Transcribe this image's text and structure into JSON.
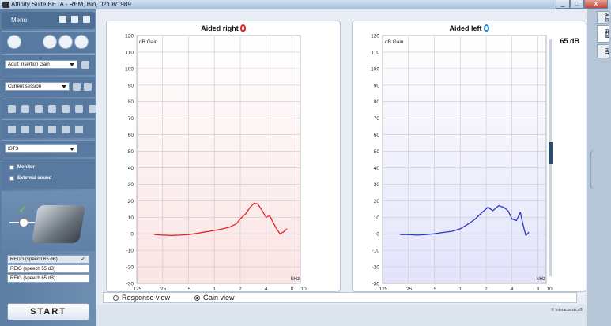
{
  "window": {
    "title": "Affinity Suite BETA - REM, Bin, 02/08/1989",
    "buttons": {
      "minimize": "_",
      "maximize": "□",
      "close": "x"
    }
  },
  "sidebar": {
    "menu_label": "Menu",
    "measurement_dropdown": "Adult Insertion Gain",
    "session_dropdown": "Current session",
    "signal_dropdown": "ISTS",
    "monitor_label": "Monitor",
    "external_sound_label": "External sound",
    "curve_list": [
      {
        "label": "REUG (speech 65 dB)",
        "selected": true
      },
      {
        "label": "REIG (speech 55 dB)",
        "selected": false
      },
      {
        "label": "REIG (speech 65 dB)",
        "selected": false
      }
    ],
    "start_label": "START"
  },
  "charts": {
    "right_title": "Aided right",
    "left_title": "Aided left",
    "level_label": "65 dB"
  },
  "view_options": {
    "response": "Response view",
    "gain": "Gain view",
    "selected": "gain"
  },
  "footer": {
    "brand": "© Interacoustics®"
  },
  "right_tabs": [
    "AUD",
    "REM",
    "HIT"
  ],
  "colors": {
    "right_curve": "#e8202a",
    "left_curve": "#2b36c8",
    "right_fill": "#fbe3e3",
    "left_fill": "#e2e3fb"
  },
  "chart_data": [
    {
      "type": "line",
      "title": "Aided right",
      "ylabel": "dB Gain",
      "xlabel": "kHz",
      "x_scale": "log",
      "xlim": [
        0.125,
        10
      ],
      "ylim": [
        -30,
        120
      ],
      "x_ticks": [
        0.125,
        0.25,
        0.5,
        1,
        2,
        4,
        8,
        10
      ],
      "x_tick_labels": [
        ".125",
        ".25",
        ".5",
        "1",
        "2",
        "4",
        "8",
        "10"
      ],
      "y_ticks": [
        120,
        110,
        100,
        90,
        80,
        70,
        60,
        50,
        40,
        30,
        20,
        10,
        0,
        -10,
        -20,
        -30
      ],
      "grid": true,
      "series": [
        {
          "color": "#e8202a",
          "points": [
            [
              0.2,
              -0.5
            ],
            [
              0.25,
              -0.8
            ],
            [
              0.315,
              -1
            ],
            [
              0.4,
              -0.8
            ],
            [
              0.5,
              -0.5
            ],
            [
              0.63,
              0.3
            ],
            [
              0.8,
              1.2
            ],
            [
              1.0,
              2
            ],
            [
              1.25,
              3
            ],
            [
              1.5,
              4
            ],
            [
              1.8,
              6
            ],
            [
              2.0,
              9
            ],
            [
              2.3,
              12
            ],
            [
              2.6,
              16
            ],
            [
              2.9,
              18.5
            ],
            [
              3.2,
              18
            ],
            [
              3.6,
              14
            ],
            [
              4.0,
              10
            ],
            [
              4.4,
              11
            ],
            [
              4.8,
              7
            ],
            [
              5.3,
              3
            ],
            [
              5.8,
              0
            ],
            [
              6.3,
              1
            ],
            [
              7.0,
              3
            ]
          ]
        }
      ]
    },
    {
      "type": "line",
      "title": "Aided left",
      "ylabel": "dB Gain",
      "xlabel": "kHz",
      "x_scale": "log",
      "xlim": [
        0.125,
        10
      ],
      "ylim": [
        -30,
        120
      ],
      "x_ticks": [
        0.125,
        0.25,
        0.5,
        1,
        2,
        4,
        8,
        10
      ],
      "x_tick_labels": [
        ".125",
        ".25",
        ".5",
        "1",
        "2",
        "4",
        "8",
        "10"
      ],
      "y_ticks": [
        120,
        110,
        100,
        90,
        80,
        70,
        60,
        50,
        40,
        30,
        20,
        10,
        0,
        -10,
        -20,
        -30
      ],
      "grid": true,
      "series": [
        {
          "color": "#2b36c8",
          "points": [
            [
              0.2,
              -0.5
            ],
            [
              0.25,
              -0.5
            ],
            [
              0.315,
              -0.8
            ],
            [
              0.4,
              -0.5
            ],
            [
              0.5,
              0
            ],
            [
              0.63,
              0.8
            ],
            [
              0.8,
              1.5
            ],
            [
              1.0,
              3
            ],
            [
              1.25,
              6
            ],
            [
              1.5,
              9
            ],
            [
              1.8,
              13
            ],
            [
              2.1,
              16
            ],
            [
              2.4,
              14
            ],
            [
              2.8,
              17
            ],
            [
              3.2,
              16
            ],
            [
              3.6,
              14
            ],
            [
              4.0,
              9
            ],
            [
              4.5,
              8
            ],
            [
              5.0,
              13
            ],
            [
              5.4,
              5
            ],
            [
              5.8,
              -1
            ],
            [
              6.3,
              1
            ]
          ]
        }
      ]
    }
  ]
}
